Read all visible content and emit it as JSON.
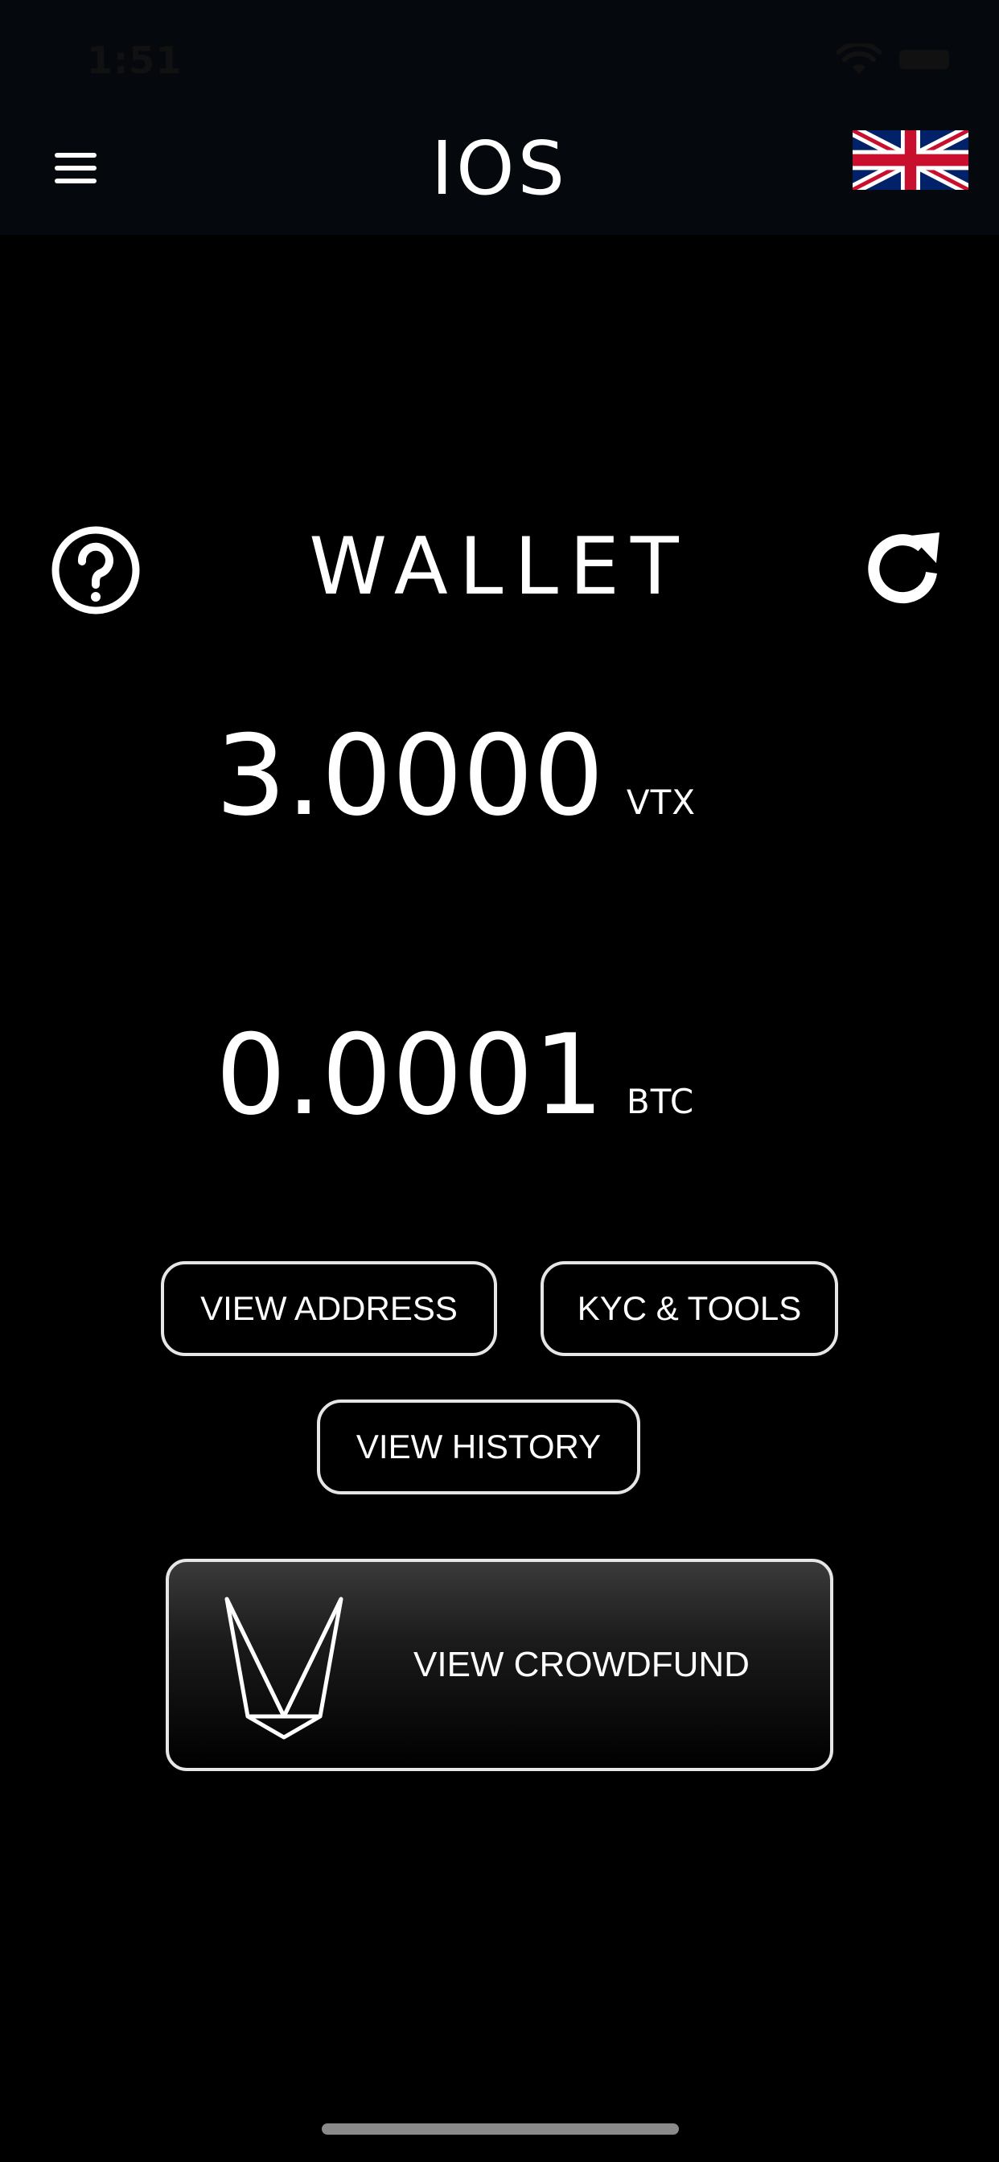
{
  "status_bar": {
    "time": "1:51"
  },
  "header": {
    "title": "IOS",
    "menu_icon": "hamburger-menu-icon",
    "language_icon": "uk-flag-icon"
  },
  "wallet": {
    "title": "WALLET",
    "help_icon": "question-circle-icon",
    "refresh_icon": "refresh-icon",
    "balances": [
      {
        "amount": "3.0000",
        "unit": "VTX"
      },
      {
        "amount": "0.0001",
        "unit": "BTC"
      }
    ]
  },
  "actions": {
    "view_address": "VIEW ADDRESS",
    "kyc_tools": "KYC & TOOLS",
    "view_history": "VIEW HISTORY",
    "view_crowdfund": "VIEW CROWDFUND",
    "crowdfund_logo": "vertex-fox-logo"
  },
  "colors": {
    "background": "#000000",
    "header_background": "#05090e",
    "button_border": "#e6e6e6",
    "text": "#ffffff"
  }
}
